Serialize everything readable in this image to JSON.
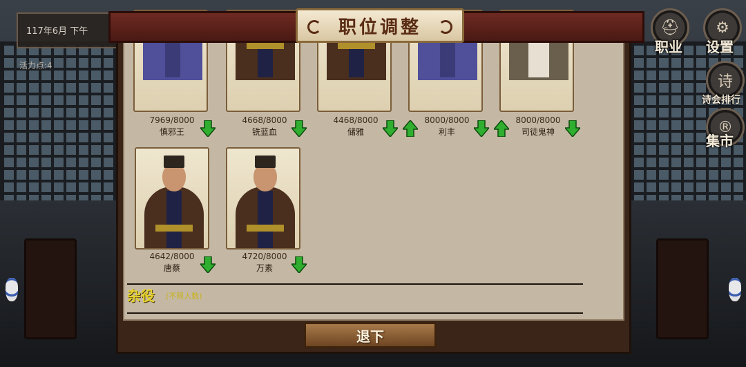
{
  "hud": {
    "date": "117年6月  下午",
    "energy": "活力点:4"
  },
  "side_buttons": {
    "job": "职业",
    "settings": "设置",
    "poetry_icon": "诗",
    "poetry": "诗会排行",
    "market_icon": "®",
    "market": "集市"
  },
  "dialog": {
    "title": "职位调整"
  },
  "officials": [
    {
      "hp": "7969/8000",
      "name": "慎邪王",
      "style": "scholar",
      "arrows": [
        "down"
      ]
    },
    {
      "hp": "4668/8000",
      "name": "铣蓝血",
      "style": "robe",
      "arrows": [
        "down"
      ]
    },
    {
      "hp": "4468/8000",
      "name": "储雅",
      "style": "robe",
      "arrows": [
        "down",
        "up"
      ]
    },
    {
      "hp": "8000/8000",
      "name": "利丰",
      "style": "scholar",
      "arrows": [
        "down",
        "up"
      ]
    },
    {
      "hp": "8000/8000",
      "name": "司徒鬼神",
      "style": "sage",
      "arrows": [
        "down"
      ]
    },
    {
      "hp": "4642/8000",
      "name": "唐蔡",
      "style": "robe",
      "arrows": [
        "down"
      ]
    },
    {
      "hp": "4720/8000",
      "name": "万素",
      "style": "robe",
      "arrows": [
        "down"
      ]
    }
  ],
  "misc_section": {
    "title": "杂役",
    "note": "(不限人数)"
  },
  "retreat_button": "退下",
  "colors": {
    "arrow_green": "#2fae2f",
    "title_red": "#5a2c14",
    "section_yellow": "#e7d22a"
  }
}
